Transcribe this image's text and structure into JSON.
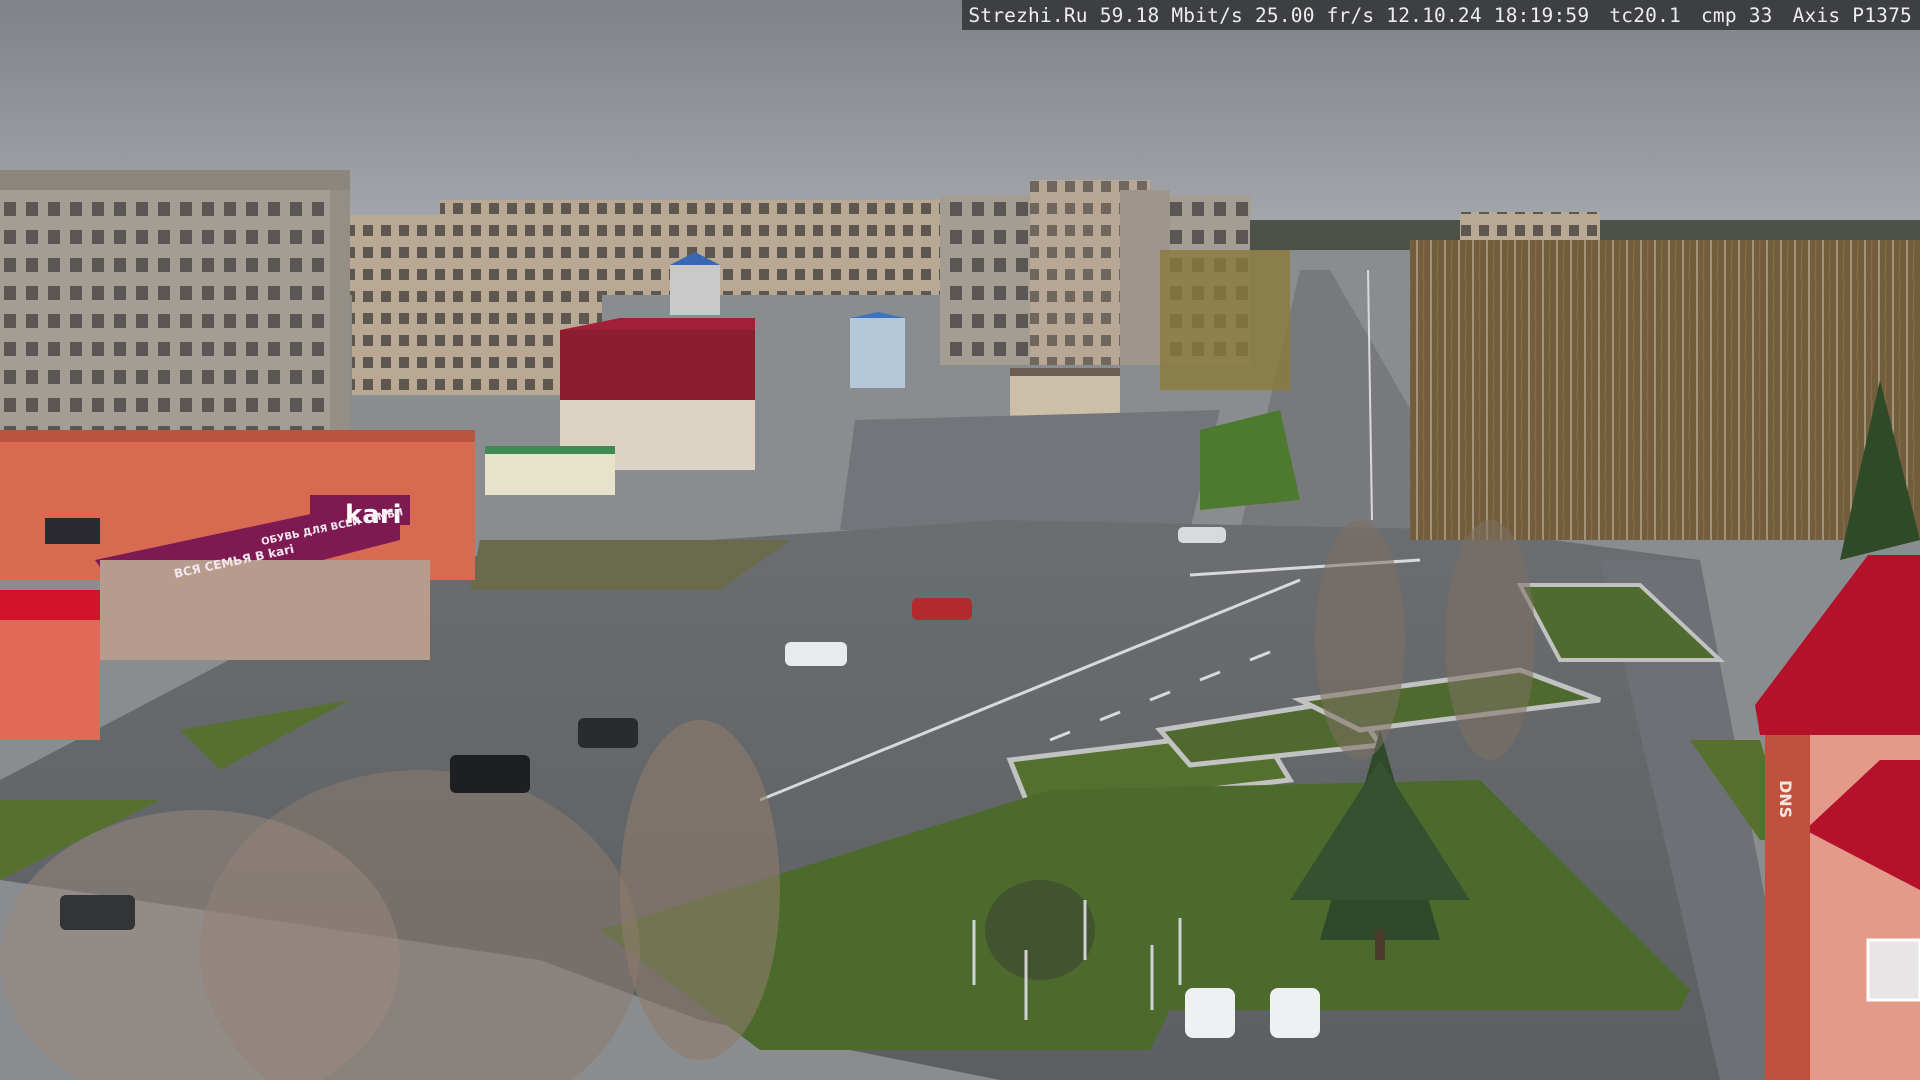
{
  "overlay": {
    "site": "Strezhi.Ru",
    "bitrate": "59.18 Mbit/s",
    "framerate": "25.00 fr/s",
    "date": "12.10.24",
    "time": "18:19:59",
    "tc": "tc20.1",
    "cmp": "cmp 33",
    "camera": "Axis P1375"
  },
  "signs": {
    "store_facade": "kari",
    "store_banner_left": "ВСЯ СЕМЬЯ В kari",
    "store_banner_mid": "ОБУВЬ ДЛЯ ВСЕЙ СЕМЬИ",
    "corner_building_sign": "DNS"
  },
  "colors": {
    "sky": "#8d9196",
    "asphalt": "#6f7275",
    "grass": "#4e6b34",
    "store_magenta": "#7d1a52",
    "roof_red": "#b4122a",
    "overlay_bg": "#3c3d40"
  }
}
